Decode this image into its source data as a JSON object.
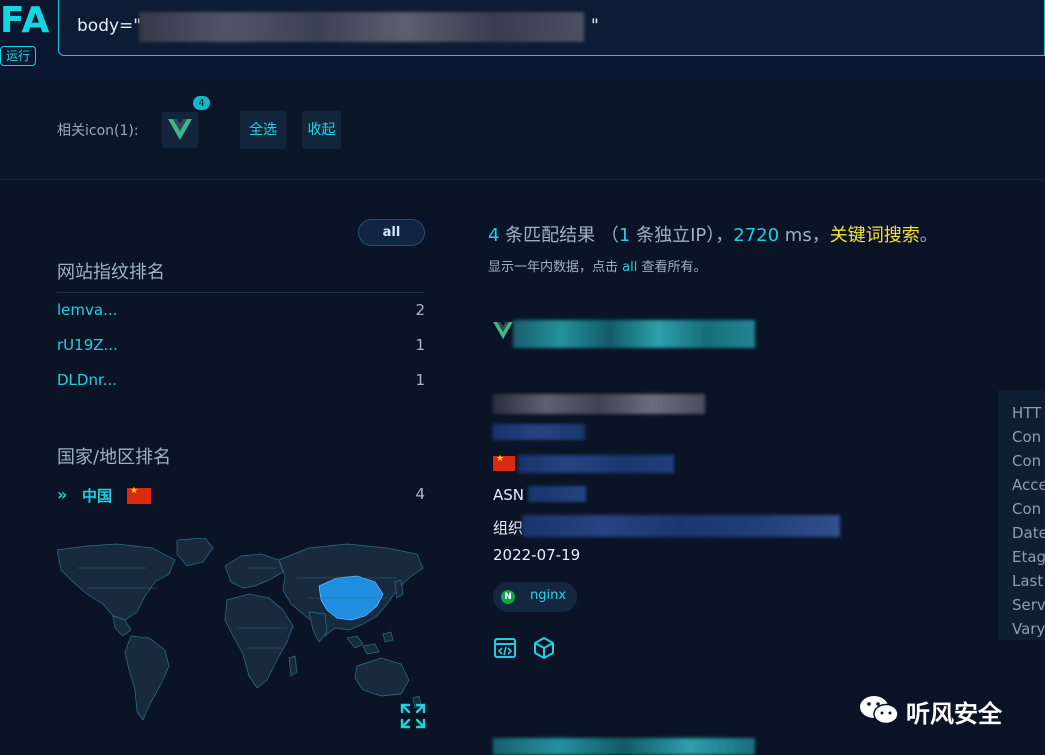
{
  "app": {
    "logo_text": "FA",
    "run_button": "运行",
    "search_query_prefix": "body=\"",
    "search_query_suffix": "\""
  },
  "icon_bar": {
    "label": "相关icon(1):",
    "icon_count": "4",
    "icon_name": "vue-logo-icon",
    "select_all": "全选",
    "collapse": "收起"
  },
  "sidebar": {
    "all_button": "all",
    "fingerprint_title": "网站指纹排名",
    "fingerprints": [
      {
        "name": "lemva...",
        "count": "2"
      },
      {
        "name": "rU19Z...",
        "count": "1"
      },
      {
        "name": "DLDnr...",
        "count": "1"
      }
    ],
    "country_title": "国家/地区排名",
    "countries": [
      {
        "name": "中国",
        "count": "4"
      }
    ]
  },
  "results": {
    "count": "4",
    "count_suffix": " 条匹配结果 （",
    "ip_count": "1",
    "ip_suffix": " 条独立IP）",
    "sep1": "，",
    "time_ms": "2720",
    "time_unit": " ms",
    "sep2": "，",
    "keyword_search": "关键词搜索",
    "period": "。",
    "note_prefix": "显示一年内数据，点击 ",
    "note_link": "all",
    "note_suffix": " 查看所有。",
    "first": {
      "asn_label": "ASN",
      "org_label": "组织",
      "date": "2022-07-19",
      "server_tag": "nginx"
    },
    "headers_preview": [
      "HTT",
      "Con",
      "Con",
      "Acce",
      "Con",
      "Date",
      "Etag",
      "Last",
      "Serv",
      "Vary"
    ]
  },
  "watermark": "听风安全",
  "colors": {
    "accent": "#12d6e4",
    "keyword": "#f1e33a",
    "background": "#0a1426"
  }
}
